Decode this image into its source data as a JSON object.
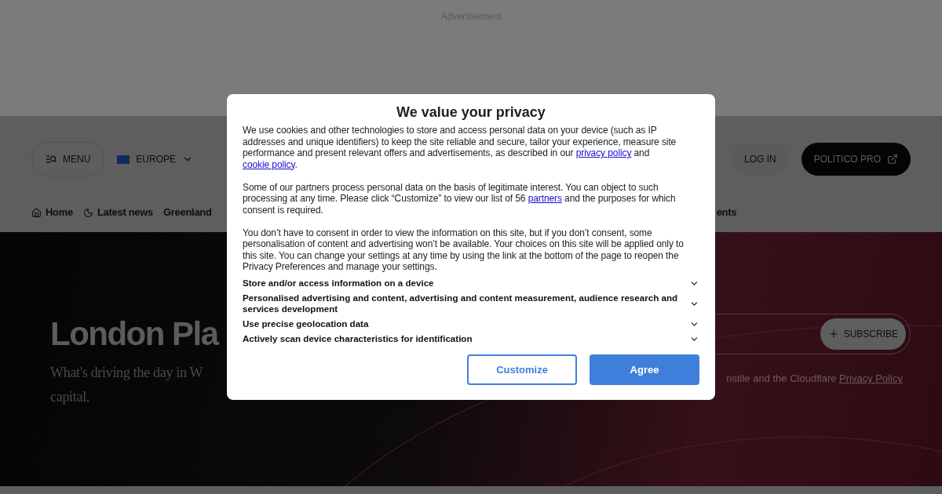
{
  "ad": {
    "label": "Advertisement"
  },
  "header": {
    "menu": "MENU",
    "region": "EUROPE",
    "login": "LOG IN",
    "pro": "POLITICO PRO"
  },
  "nav": [
    {
      "label": "Home"
    },
    {
      "label": "Latest news"
    },
    {
      "label": "Greenland"
    },
    {
      "label": "ents"
    }
  ],
  "hero": {
    "title": "London Pla",
    "subtitle_lines": [
      "What's driving the day in W",
      "capital."
    ],
    "subscribe": "SUBSCRIBE",
    "notice": "nstile and the Cloudflare",
    "notice_link": "Privacy Policy"
  },
  "dialog": {
    "title": "We value your privacy",
    "paragraphs": [
      [
        {
          "kind": "text",
          "text": "We use cookies and other technologies to store and access personal data on your device (such as IP addresses and unique identifiers) to keep the site reliable and secure, tailor your experience, measure site performance and present relevant offers and advertisements, as described in our "
        },
        {
          "kind": "link",
          "text": "privacy policy"
        },
        {
          "kind": "text",
          "text": " and "
        },
        {
          "kind": "link",
          "text": "cookie policy"
        },
        {
          "kind": "text",
          "text": "."
        }
      ],
      [
        {
          "kind": "text",
          "text": "Some of our partners process personal data on the basis of legitimate interest. You can object to such processing at any time. Please click “Customize” to view our list of 56 "
        },
        {
          "kind": "link",
          "text": "partners"
        },
        {
          "kind": "text",
          "text": " and the purposes for which consent is required."
        }
      ],
      [
        {
          "kind": "text",
          "text": "You don’t have to consent in order to view the information on this site, but if you don’t consent, some personalisation of content and advertising won’t be available. Your choices on this site will be applied only to this site. You can change your settings at any time by using the link at the bottom of the page to reopen the Privacy Preferences and manage your settings."
        }
      ]
    ],
    "purposes": [
      {
        "label": "Store and/or access information on a device",
        "expanded": false
      },
      {
        "label": "Personalised advertising and content, advertising and content measurement, audience research and services development",
        "expanded": false
      },
      {
        "label": "Use precise geolocation data",
        "expanded": false
      },
      {
        "label": "Actively scan device characteristics for identification",
        "expanded": false
      }
    ],
    "buttons": [
      {
        "label": "Customize",
        "kind": "outline"
      },
      {
        "label": "Agree",
        "kind": "primary"
      }
    ]
  }
}
